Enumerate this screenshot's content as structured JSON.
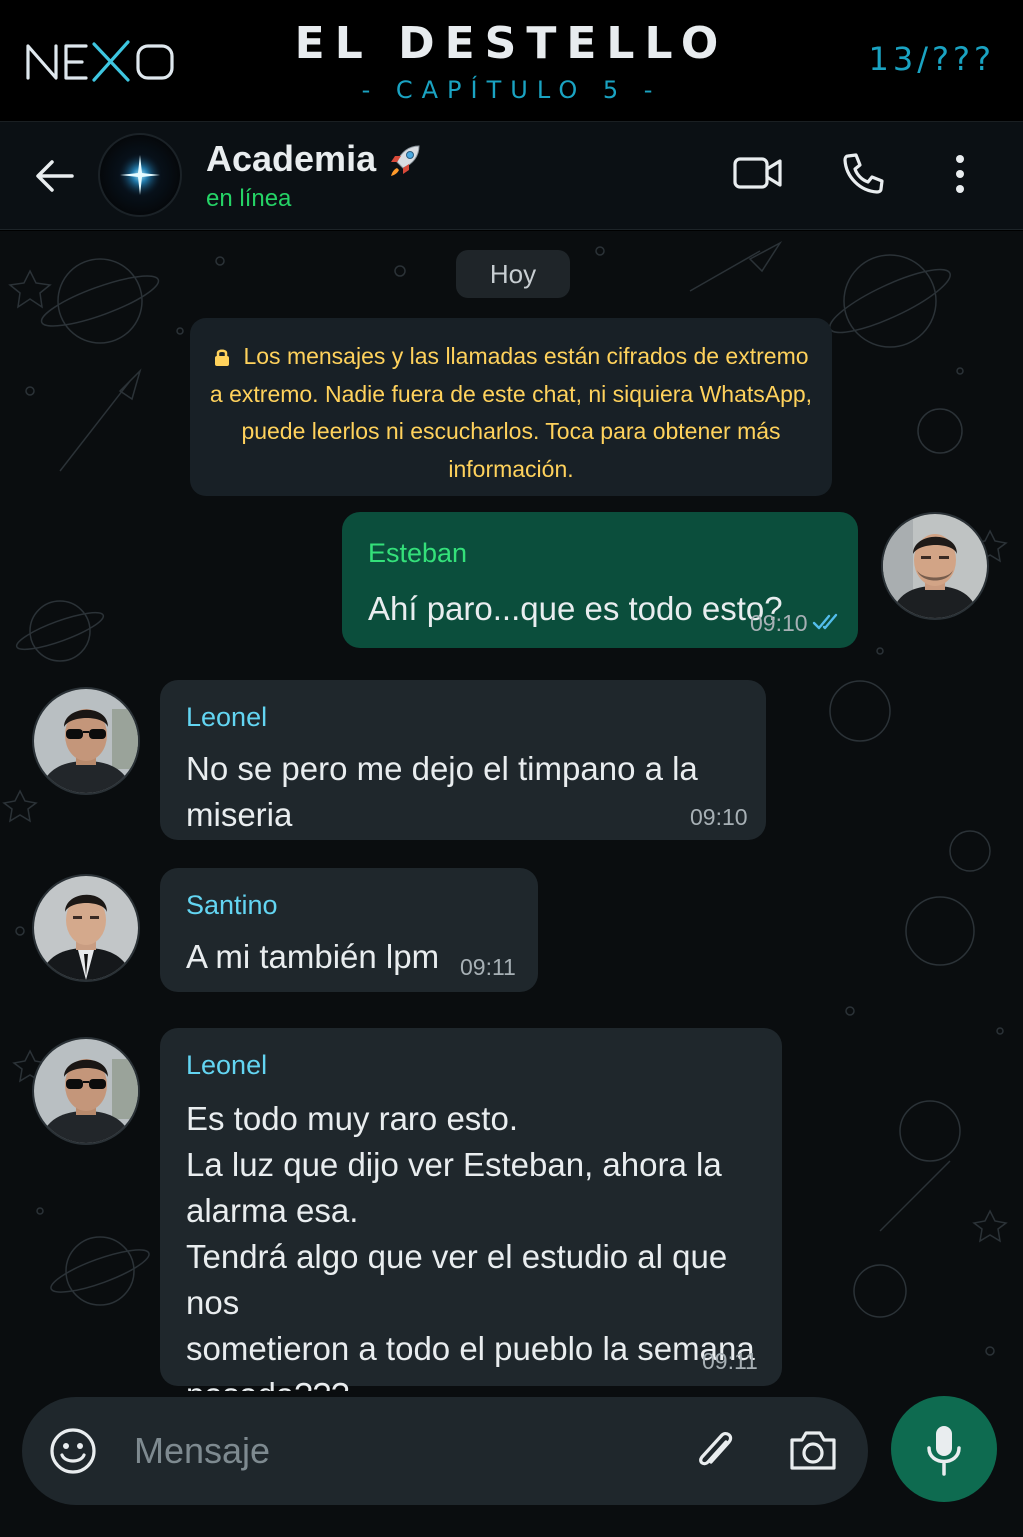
{
  "banner": {
    "logo_text": "NEXO",
    "title": "EL DESTELLO",
    "chapter": "- CAPÍTULO 5 -",
    "episode": "13/???"
  },
  "header": {
    "group_name": "Academia",
    "group_emoji": "rocket-icon",
    "status": "en línea",
    "icons": [
      "back-arrow-icon",
      "video-call-icon",
      "phone-icon",
      "more-vertical-icon"
    ]
  },
  "chat": {
    "date_chip": "Hoy",
    "e2e_notice": "Los mensajes y las llamadas están cifrados de extremo a extremo. Nadie fuera de este chat, ni siquiera WhatsApp, puede leerlos ni escucharlos. Toca para obtener más información.",
    "messages": [
      {
        "direction": "out",
        "sender": "Esteban",
        "text": "Ahí paro...que es todo esto?",
        "time": "09:10",
        "status": "read"
      },
      {
        "direction": "in",
        "sender": "Leonel",
        "text": "No se pero me dejo el timpano a la miseria",
        "time": "09:10"
      },
      {
        "direction": "in",
        "sender": "Santino",
        "text": "A mi también lpm",
        "time": "09:11"
      },
      {
        "direction": "in",
        "sender": "Leonel",
        "text": "Es todo muy raro esto.\nLa luz que dijo ver Esteban, ahora la\nalarma esa.\nTendrá algo que ver el estudio al que nos\nsometieron a todo el pueblo la semana\npasada???",
        "time": "09:11"
      }
    ]
  },
  "composer": {
    "placeholder": "Mensaje",
    "icons": [
      "emoji-icon",
      "attach-icon",
      "camera-icon",
      "mic-icon"
    ]
  },
  "colors": {
    "accent": "#1aa3c2",
    "online": "#25d366",
    "outgoing_bubble": "#0b4e3c",
    "incoming_bubble": "#1f272c",
    "notice_text": "#ffd25c",
    "mic_button": "#0e6b50"
  }
}
